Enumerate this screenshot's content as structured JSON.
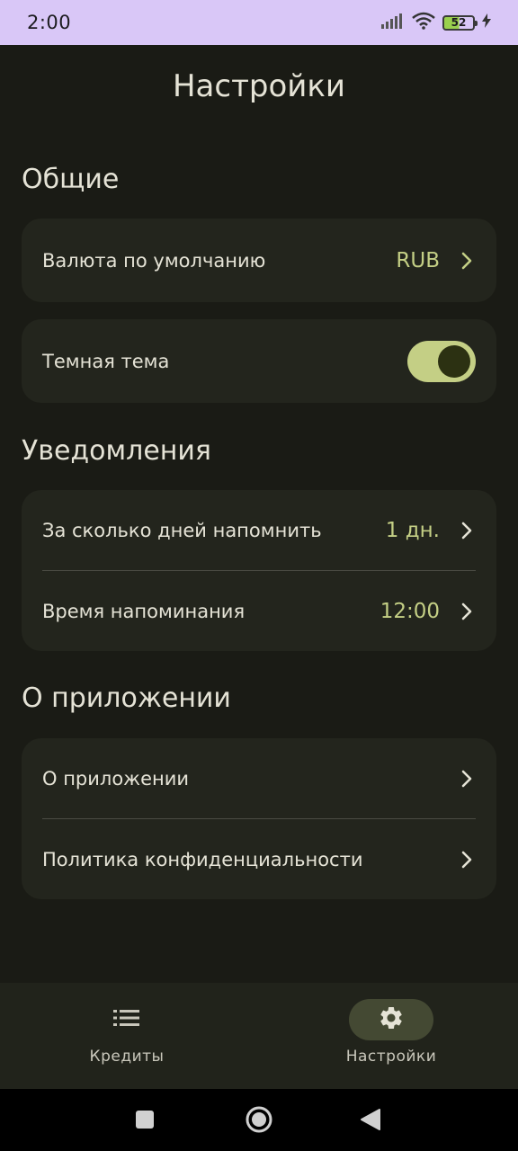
{
  "status_bar": {
    "time": "2:00",
    "battery_level": "52"
  },
  "header": {
    "title": "Настройки"
  },
  "sections": {
    "general": {
      "title": "Общие",
      "currency_label": "Валюта по умолчанию",
      "currency_value": "RUB",
      "dark_theme_label": "Темная тема",
      "dark_theme_on": true
    },
    "notifications": {
      "title": "Уведомления",
      "days_label": "За сколько дней напомнить",
      "days_value": "1 дн.",
      "time_label": "Время напоминания",
      "time_value": "12:00"
    },
    "about": {
      "title": "О приложении",
      "about_label": "О приложении",
      "privacy_label": "Политика конфиденциальности"
    }
  },
  "bottom_nav": {
    "items": [
      {
        "label": "Кредиты",
        "icon": "list-icon",
        "active": false
      },
      {
        "label": "Настройки",
        "icon": "gear-icon",
        "active": true
      }
    ]
  },
  "colors": {
    "background": "#1a1b15",
    "card": "#23251d",
    "accent": "#c4cf85",
    "status_bar": "#d9c7f7"
  }
}
